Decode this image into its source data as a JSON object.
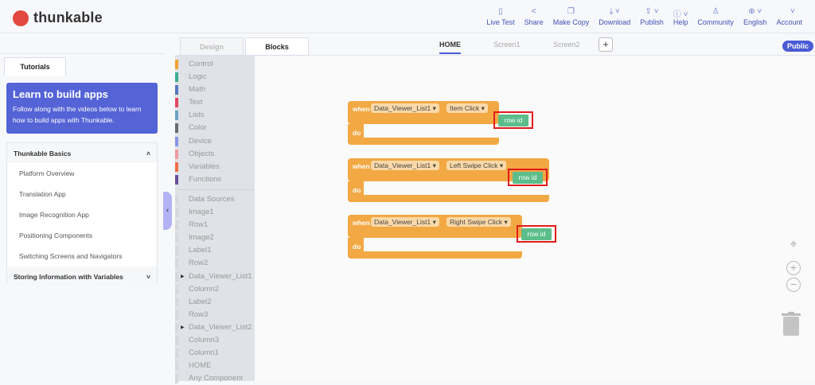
{
  "header": {
    "brand": "thunkable",
    "nav": [
      {
        "label": "Live Test",
        "icon": "phone-icon"
      },
      {
        "label": "Share",
        "icon": "share-icon"
      },
      {
        "label": "Make Copy",
        "icon": "copy-icon"
      },
      {
        "label": "Download",
        "icon": "download-icon"
      },
      {
        "label": "Publish",
        "icon": "publish-icon"
      },
      {
        "label": "Help",
        "icon": "info-icon"
      },
      {
        "label": "Community",
        "icon": "community-icon"
      },
      {
        "label": "English",
        "icon": "globe-icon"
      },
      {
        "label": "Account",
        "icon": "account-icon"
      }
    ]
  },
  "left": {
    "tab": "Tutorials",
    "banner_title": "Learn to build apps",
    "banner_text": "Follow along with the videos below to learn how to build apps with Thunkable.",
    "section1": "Thunkable Basics",
    "items": [
      "Platform Overview",
      "Translation App",
      "Image Recognition App",
      "Positioning Components",
      "Switching Screens and Navigators"
    ],
    "section2": "Storing Information with Variables"
  },
  "tabs": {
    "design": "Design",
    "blocks": "Blocks",
    "screens": [
      "HOME",
      "Screen1",
      "Screen2"
    ],
    "add": "+",
    "public": "Public"
  },
  "toolbox": {
    "builtin": [
      {
        "label": "Control",
        "color": "#f2a032"
      },
      {
        "label": "Logic",
        "color": "#3aae93"
      },
      {
        "label": "Math",
        "color": "#5576c0"
      },
      {
        "label": "Text",
        "color": "#e0465e"
      },
      {
        "label": "Lists",
        "color": "#6ba3c7"
      },
      {
        "label": "Color",
        "color": "#6b6b6b"
      },
      {
        "label": "Device",
        "color": "#8a93e6"
      },
      {
        "label": "Objects",
        "color": "#f29aa0"
      },
      {
        "label": "Variables",
        "color": "#f26b45"
      },
      {
        "label": "Functions",
        "color": "#6a4e9e"
      }
    ],
    "components": [
      "Data Sources",
      "Image1",
      "Row1",
      "Image2",
      "Label1",
      "Row2",
      "Data_Viewer_List1",
      "Column2",
      "Label2",
      "Row3",
      "Data_Viewer_List2",
      "Column3",
      "Column1",
      "HOME",
      "Any Component"
    ]
  },
  "blocks": [
    {
      "when": "when",
      "component": "Data_Viewer_List1",
      "event": "Item Click",
      "do": "do",
      "param": "row id"
    },
    {
      "when": "when",
      "component": "Data_Viewer_List1",
      "event": "Left Swipe Click",
      "do": "do",
      "param": "row id"
    },
    {
      "when": "when",
      "component": "Data_Viewer_List1",
      "event": "Right Swipe Click",
      "do": "do",
      "param": "row id"
    }
  ]
}
